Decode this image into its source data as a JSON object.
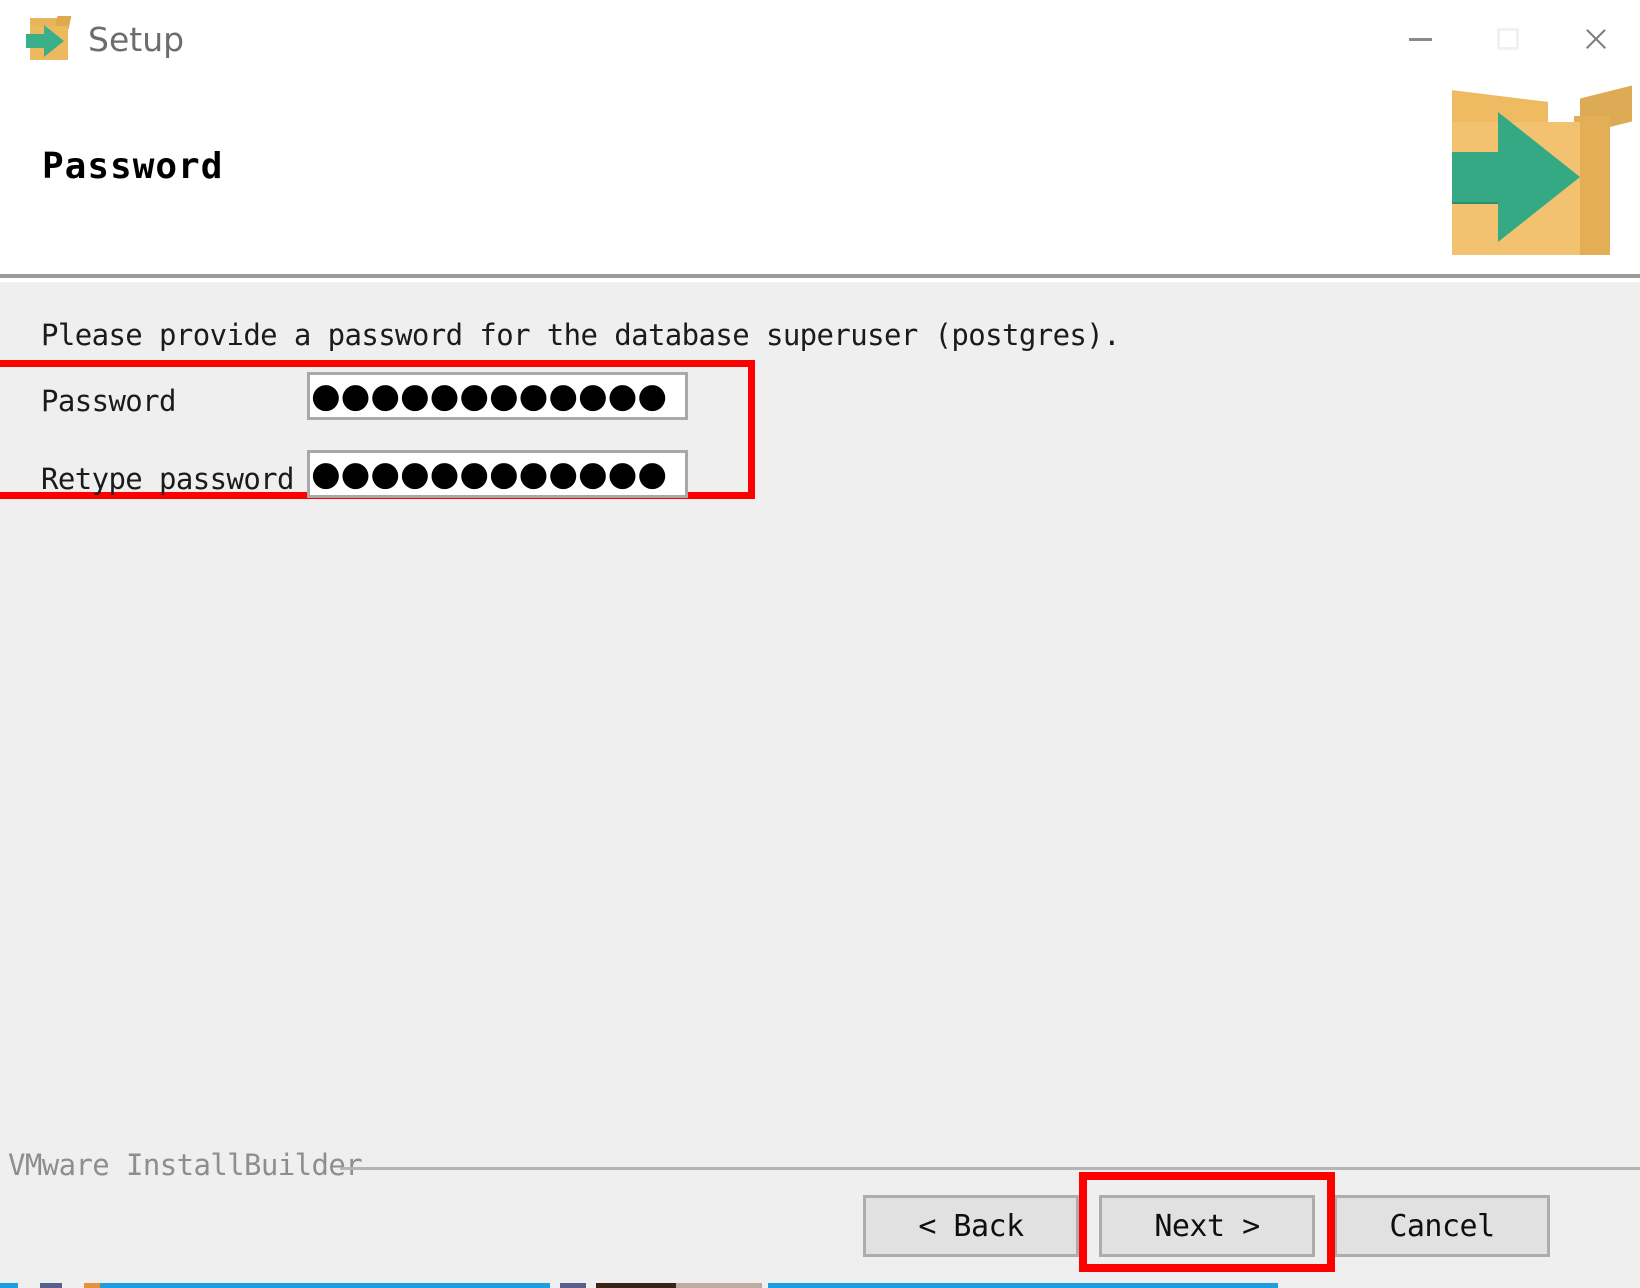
{
  "window": {
    "title": "Setup",
    "icon": "installer-box-icon",
    "controls": {
      "minimize": "minimize-icon",
      "maximize": "maximize-icon",
      "close": "close-icon"
    }
  },
  "header": {
    "page_title": "Password",
    "logo": "installbuilder-box-arrow-logo"
  },
  "main": {
    "instruction": "Please provide a password for the database superuser (postgres).",
    "fields": [
      {
        "label": "Password",
        "name": "password-input",
        "masked_value": "●●●●●●●●●●●●",
        "char_count": 12
      },
      {
        "label": "Retype password",
        "name": "retype-password-input",
        "masked_value": "●●●●●●●●●●●●",
        "char_count": 12
      }
    ],
    "highlight_color": "#fe0000"
  },
  "footer": {
    "brand": "VMware InstallBuilder",
    "buttons": {
      "back": "< Back",
      "next": "Next >",
      "cancel": "Cancel"
    },
    "highlighted_button": "Next >"
  },
  "colors": {
    "body_background": "#efefef",
    "header_background": "#ffffff",
    "accent_red": "#fe0000",
    "box_orange": "#f2c270",
    "arrow_green": "#35a983",
    "button_face": "#e1e1e1"
  }
}
